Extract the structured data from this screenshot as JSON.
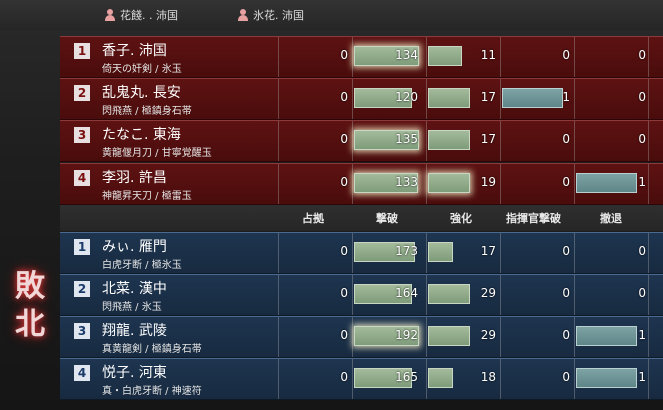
{
  "top_players": [
    {
      "name": "花餞. . 沛国"
    },
    {
      "name": "氷花. 沛国"
    }
  ],
  "defeat_label": "敗北",
  "headers": [
    "占拠",
    "撃破",
    "強化",
    "指揮官撃破",
    "撤退"
  ],
  "red_team": [
    {
      "rank": "1",
      "name": "香子. 沛国",
      "equip": "倚天の奸剣 / 氷玉",
      "v": [
        "0",
        "134",
        "11",
        "0",
        "0"
      ],
      "bars": [
        0.95,
        0.75,
        0,
        0
      ]
    },
    {
      "rank": "2",
      "name": "乱鬼丸. 長安",
      "equip": "閃飛燕 / 極鎮身石帯",
      "v": [
        "0",
        "120",
        "17",
        "1",
        "0"
      ],
      "bars": [
        0.85,
        0.95,
        0.9,
        0
      ]
    },
    {
      "rank": "3",
      "name": "たなこ. 東海",
      "equip": "黄龍偃月刀 / 甘寧覚醒玉",
      "v": [
        "0",
        "135",
        "17",
        "0",
        "0"
      ],
      "bars": [
        0.96,
        0.95,
        0,
        0
      ]
    },
    {
      "rank": "4",
      "name": "李羽. 許昌",
      "equip": "神龍昇天刀 / 極雷玉",
      "v": [
        "0",
        "133",
        "19",
        "0",
        "1"
      ],
      "bars": [
        0.94,
        0.95,
        0,
        0.9
      ]
    }
  ],
  "blue_team": [
    {
      "rank": "1",
      "name": "みぃ. 雁門",
      "equip": "白虎牙断 / 極氷玉",
      "v": [
        "0",
        "173",
        "17",
        "0",
        "0"
      ],
      "bars": [
        0.9,
        0.55,
        0,
        0
      ]
    },
    {
      "rank": "2",
      "name": "北菜. 漢中",
      "equip": "閃飛燕 / 氷玉",
      "v": [
        "0",
        "164",
        "29",
        "0",
        "0"
      ],
      "bars": [
        0.85,
        0.95,
        0,
        0
      ]
    },
    {
      "rank": "3",
      "name": "翔龍. 武陵",
      "equip": "真黄龍剣 / 極鎮身石帯",
      "v": [
        "0",
        "192",
        "29",
        "0",
        "1"
      ],
      "bars": [
        0.95,
        0.95,
        0,
        0.9
      ]
    },
    {
      "rank": "4",
      "name": "悦子. 河東",
      "equip": "真・白虎牙断 / 神速符",
      "v": [
        "0",
        "165",
        "18",
        "0",
        "1"
      ],
      "bars": [
        0.85,
        0.55,
        0,
        0.9
      ]
    }
  ]
}
